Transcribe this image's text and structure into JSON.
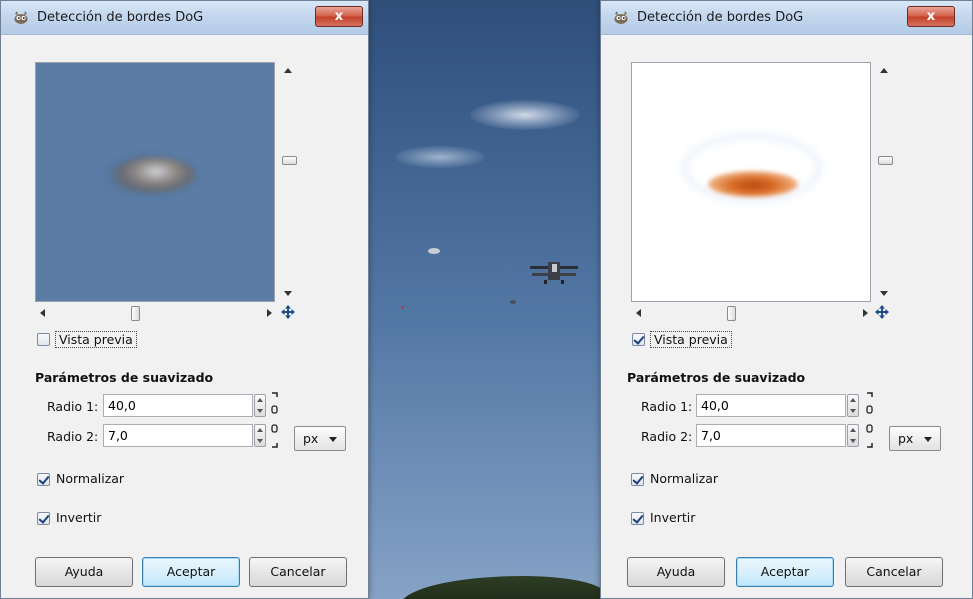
{
  "background": {
    "description_colors": {
      "sky_top": "#2f4f7b",
      "sky_bottom": "#86a2c6"
    }
  },
  "dialogs": [
    {
      "id": "left",
      "title": "Detección de bordes DoG",
      "close_label": "x",
      "preview": {
        "style": "blurred"
      },
      "preview_checkbox": {
        "label": "Vista previa",
        "checked": false
      },
      "section_title": "Parámetros de suavizado",
      "radio1": {
        "label": "Radio 1:",
        "value": "40,0"
      },
      "radio2": {
        "label": "Radio 2:",
        "value": "7,0"
      },
      "unit": "px",
      "normalize": {
        "label": "Normalizar",
        "checked": true
      },
      "invert": {
        "label": "Invertir",
        "checked": true
      },
      "buttons": {
        "help": "Ayuda",
        "ok": "Aceptar",
        "cancel": "Cancelar"
      }
    },
    {
      "id": "right",
      "title": "Detección de bordes DoG",
      "close_label": "x",
      "preview": {
        "style": "edges"
      },
      "preview_checkbox": {
        "label": "Vista previa",
        "checked": true
      },
      "section_title": "Parámetros de suavizado",
      "radio1": {
        "label": "Radio 1:",
        "value": "40,0"
      },
      "radio2": {
        "label": "Radio 2:",
        "value": "7,0"
      },
      "unit": "px",
      "normalize": {
        "label": "Normalizar",
        "checked": true
      },
      "invert": {
        "label": "Invertir",
        "checked": true
      },
      "buttons": {
        "help": "Ayuda",
        "ok": "Aceptar",
        "cancel": "Cancelar"
      }
    }
  ],
  "icons": {
    "title": "gimp-wilber-icon",
    "navigate": "navigate-move-icon",
    "chain": "chain-link-icon"
  },
  "accent_colors": {
    "close_button": "#c2412a",
    "default_button_border": "#3c7fb1"
  }
}
